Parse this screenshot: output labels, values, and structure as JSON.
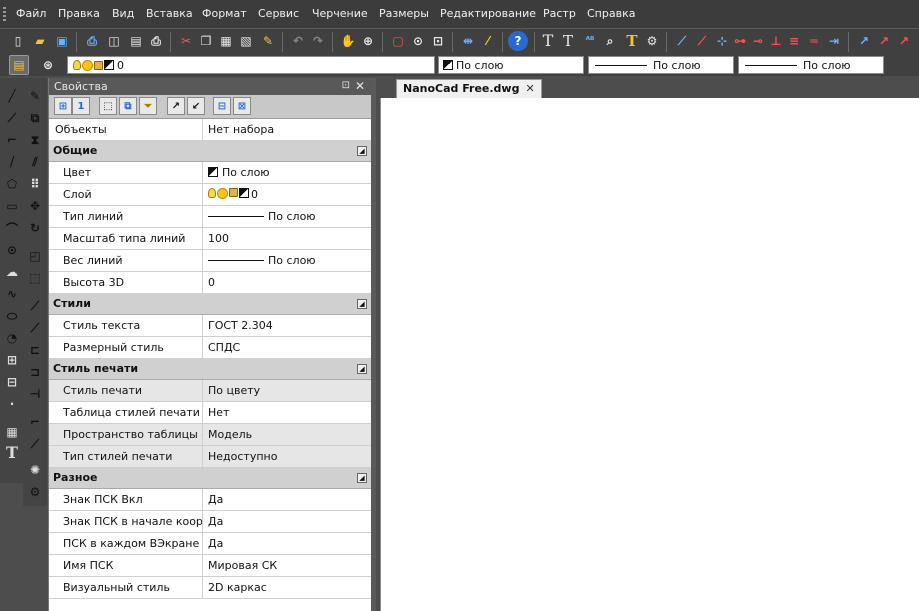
{
  "menu": [
    "Файл",
    "Правка",
    "Вид",
    "Вставка",
    "Формат",
    "Сервис",
    "Черчение",
    "Размеры",
    "Редактирование",
    "Растр",
    "Справка"
  ],
  "layer_bar": {
    "layer_value": "0",
    "color_value": "По слою",
    "linetype_value": "По слою",
    "lineweight_value": "По слою"
  },
  "properties_panel": {
    "title": "Свойства",
    "objects_label": "Объекты",
    "objects_value": "Нет набора",
    "sections": [
      {
        "title": "Общие",
        "rows": [
          {
            "key": "Цвет",
            "value": "По слою"
          },
          {
            "key": "Слой",
            "value": "0"
          },
          {
            "key": "Тип линий",
            "value": "По слою"
          },
          {
            "key": "Масштаб типа линий",
            "value": "100"
          },
          {
            "key": "Вес линий",
            "value": "По слою"
          },
          {
            "key": "Высота 3D",
            "value": "0"
          }
        ]
      },
      {
        "title": "Стили",
        "rows": [
          {
            "key": "Стиль текста",
            "value": "ГОСТ 2.304"
          },
          {
            "key": "Размерный стиль",
            "value": "СПДС"
          }
        ]
      },
      {
        "title": "Стиль печати",
        "rows": [
          {
            "key": "Стиль печати",
            "value": "По цвету"
          },
          {
            "key": "Таблица стилей печати",
            "value": "Нет"
          },
          {
            "key": "Пространство таблицы с...",
            "value": "Модель"
          },
          {
            "key": "Тип стилей печати",
            "value": "Недоступно"
          }
        ]
      },
      {
        "title": "Разное",
        "rows": [
          {
            "key": "Знак ПСК Вкл",
            "value": "Да"
          },
          {
            "key": "Знак ПСК в начале коорд...",
            "value": "Да"
          },
          {
            "key": "ПСК в каждом ВЭкране",
            "value": "Да"
          },
          {
            "key": "Имя ПСК",
            "value": "Мировая СК"
          },
          {
            "key": "Визуальный стиль",
            "value": "2D каркас"
          }
        ]
      }
    ]
  },
  "document": {
    "tab_label": "NanoCad Free.dwg"
  },
  "icons": {
    "pin": "⊡",
    "close": "✕",
    "section_toggle": "◢"
  }
}
